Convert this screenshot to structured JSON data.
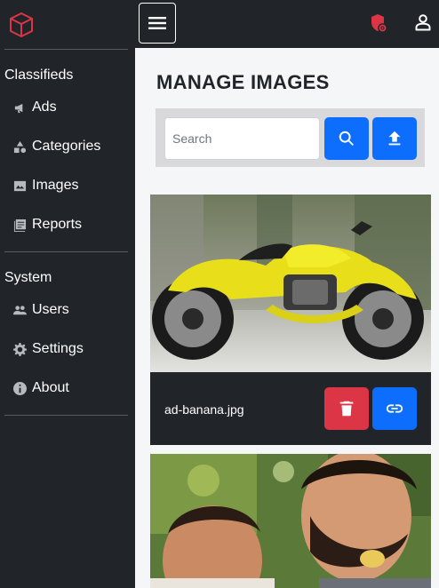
{
  "sidebar": {
    "sections": [
      {
        "title": "Classifieds",
        "items": [
          {
            "label": "Ads",
            "icon": "megaphone-icon"
          },
          {
            "label": "Categories",
            "icon": "shapes-icon"
          },
          {
            "label": "Images",
            "icon": "image-icon"
          },
          {
            "label": "Reports",
            "icon": "report-icon"
          }
        ]
      },
      {
        "title": "System",
        "items": [
          {
            "label": "Users",
            "icon": "users-icon"
          },
          {
            "label": "Settings",
            "icon": "gear-icon"
          },
          {
            "label": "About",
            "icon": "info-icon"
          }
        ]
      }
    ]
  },
  "main": {
    "title": "MANAGE IMAGES",
    "search": {
      "placeholder": "Search",
      "value": ""
    },
    "images": [
      {
        "filename": "ad-banana.jpg"
      }
    ]
  },
  "colors": {
    "sidebar_bg": "#212529",
    "primary": "#0d6efd",
    "danger": "#dc3545",
    "notification": "#dc3545"
  }
}
